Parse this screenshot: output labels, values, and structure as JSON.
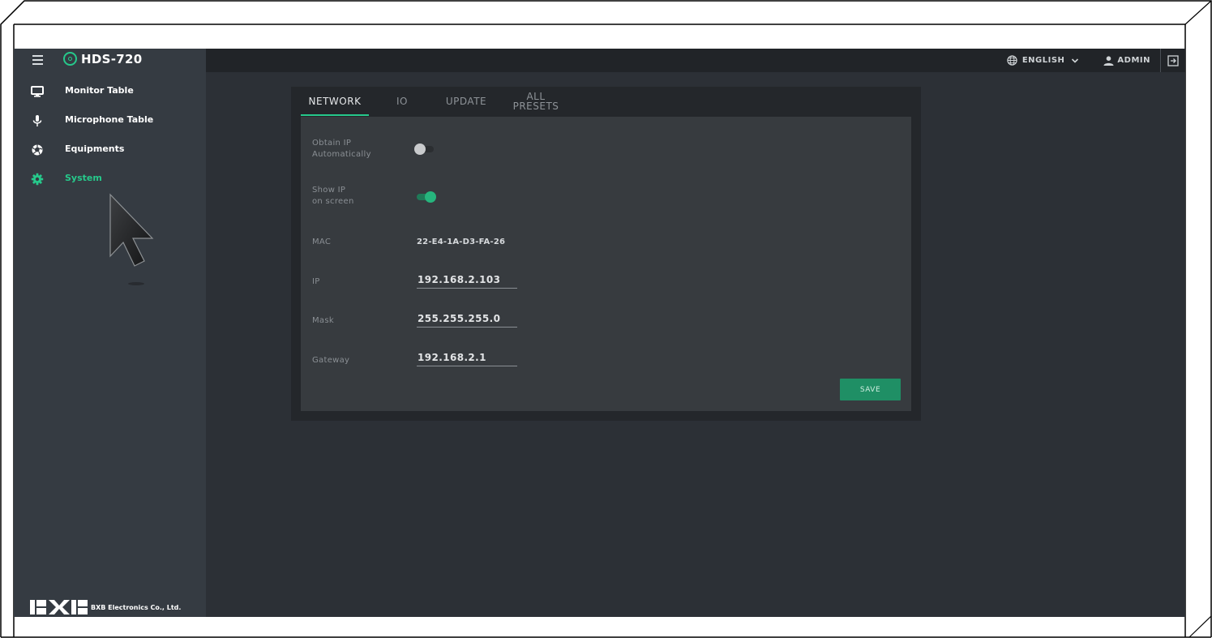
{
  "app": {
    "brand_name": "HDS-720",
    "accent_color": "#26c98b"
  },
  "topbar": {
    "language_label": "ENGLISH",
    "user_label": "ADMIN",
    "icons": [
      "menu-icon",
      "logo-icon",
      "globe-icon",
      "chevron-down-icon",
      "person-icon",
      "logout-icon"
    ]
  },
  "sidebar": {
    "items": [
      {
        "label": "Monitor Table",
        "icon": "monitor-icon",
        "active": false
      },
      {
        "label": "Microphone Table",
        "icon": "microphone-icon",
        "active": false
      },
      {
        "label": "Equipments",
        "icon": "aperture-icon",
        "active": false
      },
      {
        "label": "System",
        "icon": "gear-icon",
        "active": true
      }
    ],
    "footer_logo_text": "BXB",
    "footer_text": "BXB Electronics Co., Ltd."
  },
  "tabs": {
    "network": "NETWORK",
    "io": "IO",
    "update": "UPDATE",
    "all_presets_line1": "ALL",
    "all_presets_line2": "PRESETS",
    "active": "NETWORK"
  },
  "network": {
    "obtain_ip_label_1": "Obtain IP",
    "obtain_ip_label_2": "Automatically",
    "obtain_ip_enabled": false,
    "show_ip_label_1": "Show IP",
    "show_ip_label_2": "on screen",
    "show_ip_enabled": true,
    "mac_label": "MAC",
    "mac_value": "22-E4-1A-D3-FA-26",
    "ip_label": "IP",
    "ip_value": "192.168.2.103",
    "mask_label": "Mask",
    "mask_value": "255.255.255.0",
    "gateway_label": "Gateway",
    "gateway_value": "192.168.2.1",
    "save_label": "SAVE"
  }
}
